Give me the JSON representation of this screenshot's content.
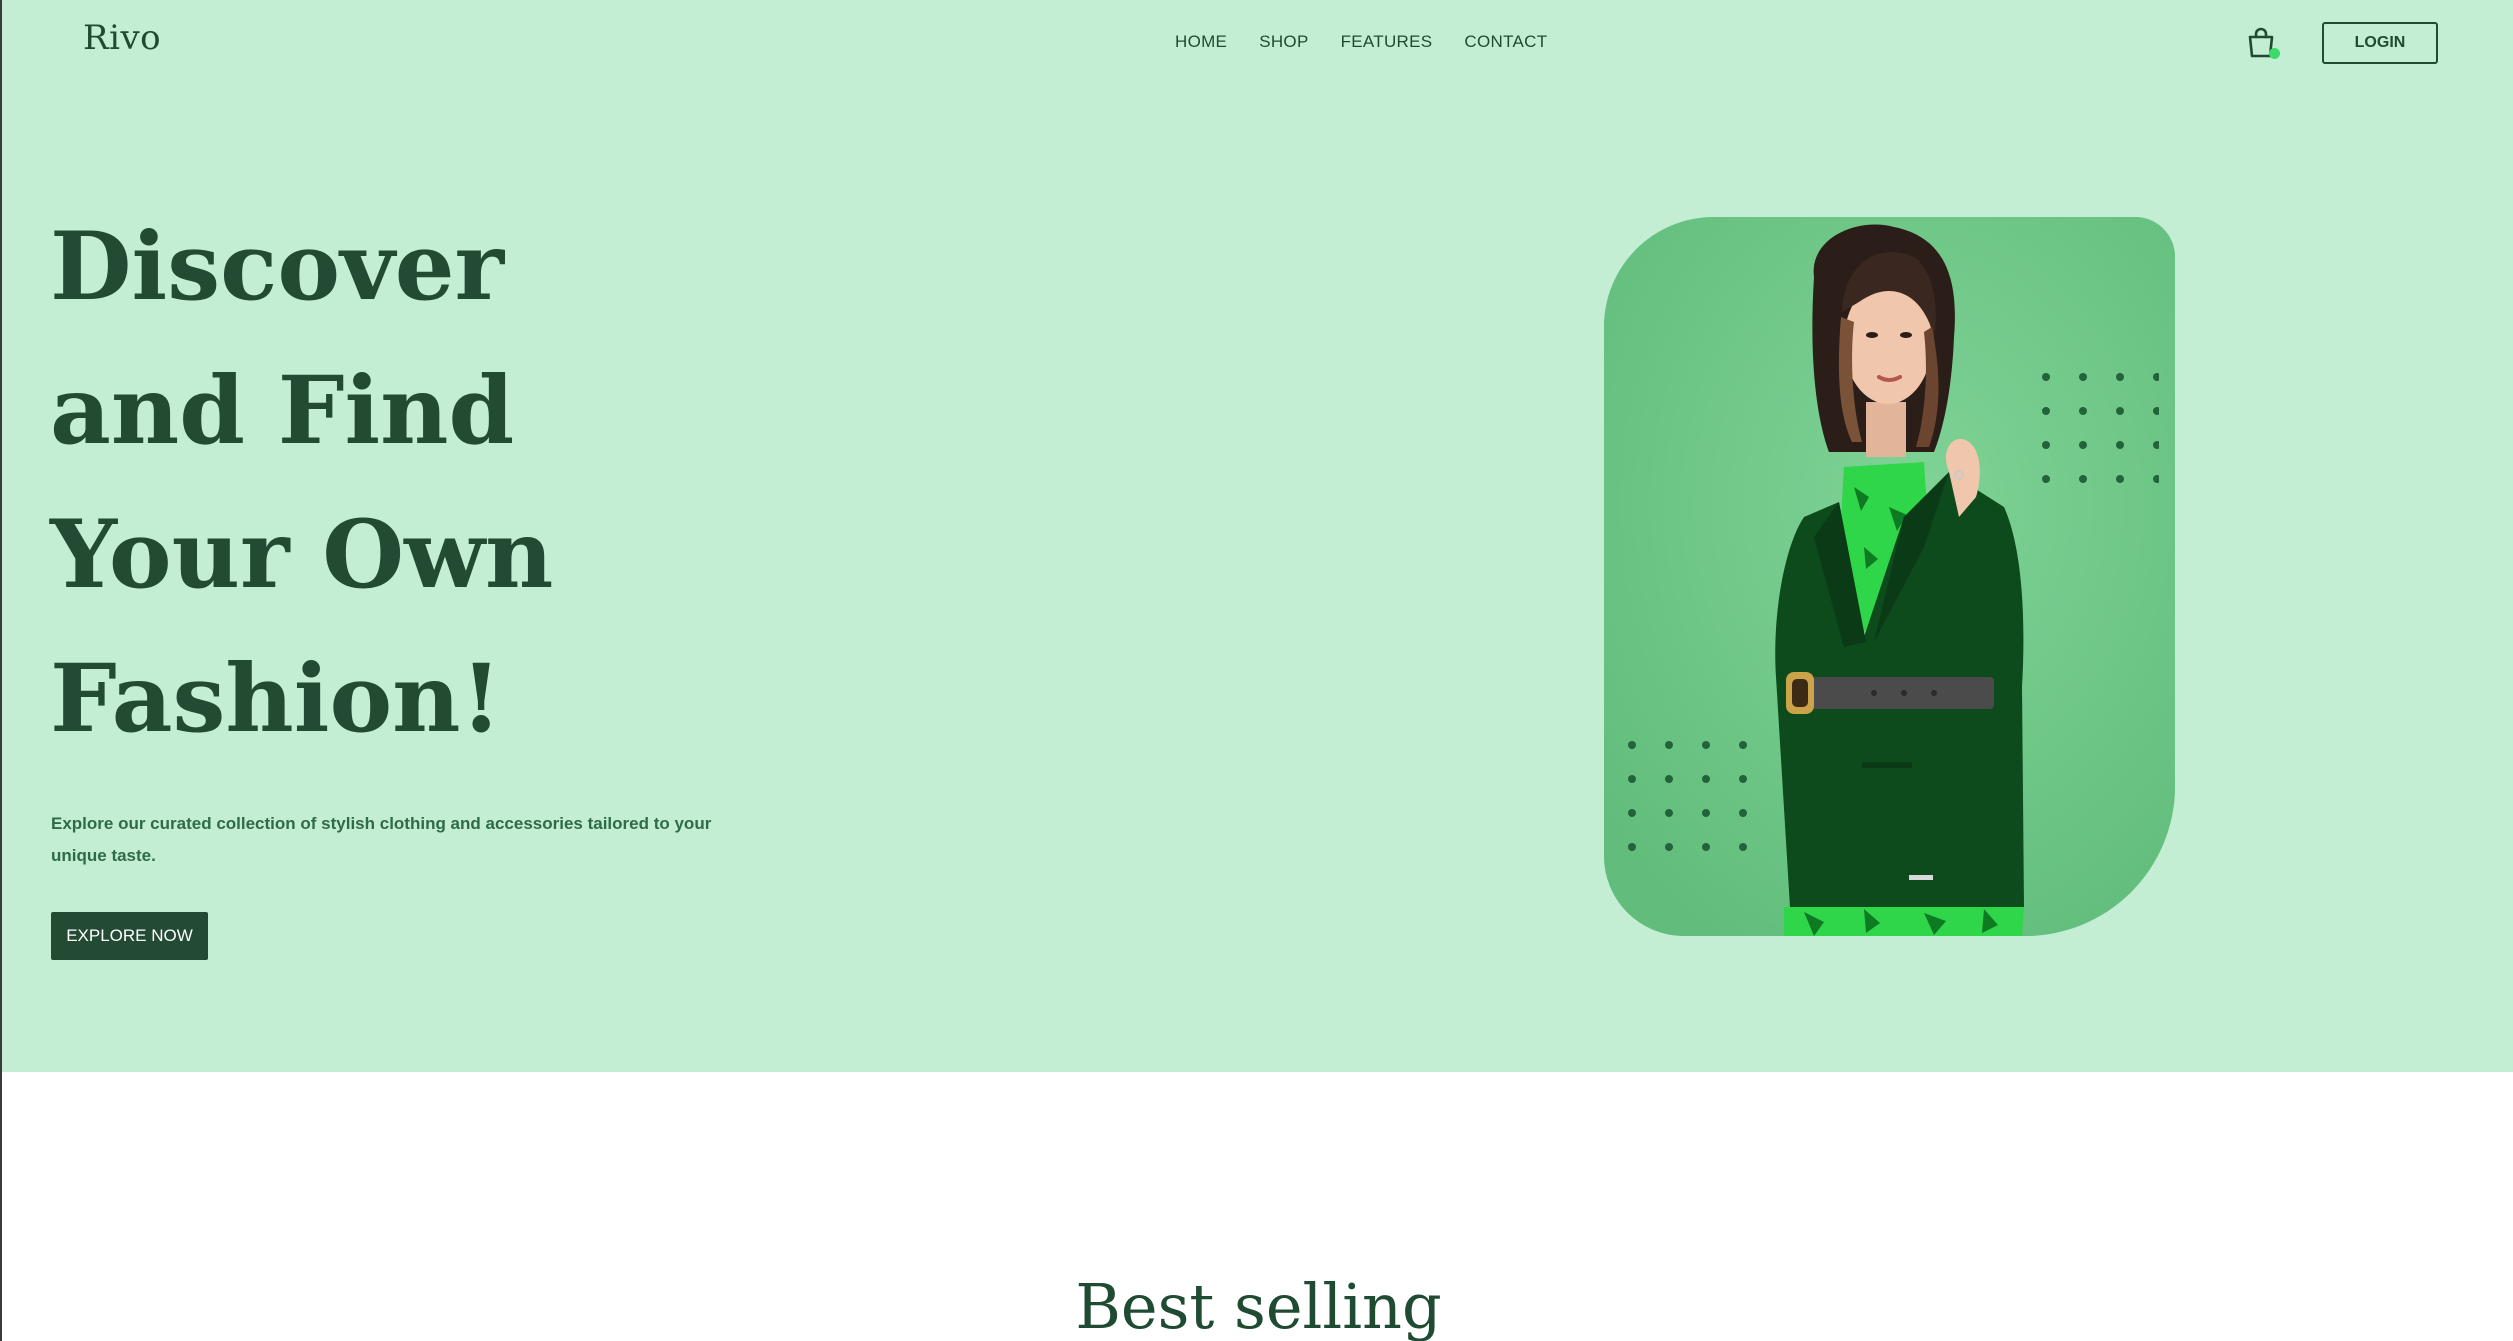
{
  "brand": {
    "logo_text": "Rivo"
  },
  "nav": {
    "items": [
      {
        "label": "HOME"
      },
      {
        "label": "SHOP"
      },
      {
        "label": "FEATURES"
      },
      {
        "label": "CONTACT"
      }
    ]
  },
  "header": {
    "cart_icon": "shopping-bag-icon",
    "cart_badge_color": "#3ddc6a",
    "login_label": "LOGIN"
  },
  "hero": {
    "headline_lines": [
      "Discover",
      "and Find",
      "Your Own",
      "Fashion!"
    ],
    "subtitle": "Explore our curated collection of stylish clothing and accessories tailored to your unique taste.",
    "cta_label": "EXPLORE NOW",
    "image_subject": "woman in green blazer"
  },
  "sections": {
    "best_selling_title": "Best selling"
  },
  "colors": {
    "hero_background": "#c3eed4",
    "primary_dark": "#234a33",
    "card_green": "#6cc686",
    "accent_green": "#3ddc6a"
  }
}
